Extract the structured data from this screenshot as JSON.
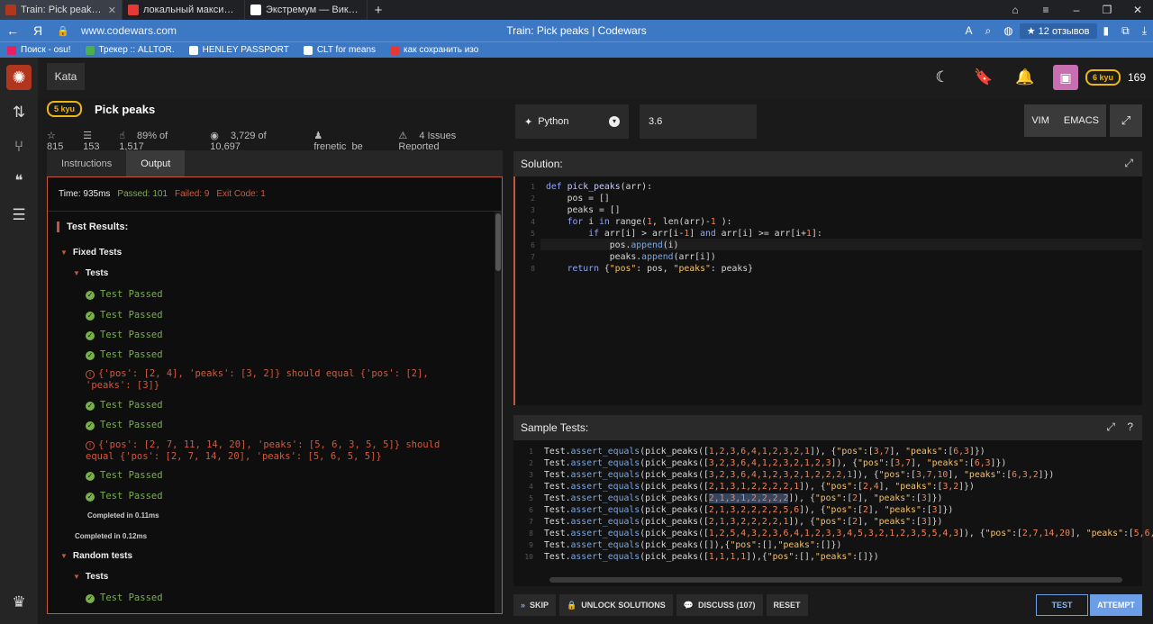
{
  "browser": {
    "tabs": [
      {
        "title": "Train: Pick peaks | Codew",
        "color": "#b1361e"
      },
      {
        "title": "локальный максимум — Я",
        "color": "#e53935"
      },
      {
        "title": "Экстремум — Википедия",
        "color": "#ffffff"
      }
    ],
    "new_tab": "+",
    "url": "www.codewars.com",
    "page_title": "Train: Pick peaks | Codewars",
    "reviews": "★ 12 отзывов",
    "bookmarks": [
      {
        "label": "Поиск - osu!",
        "color": "#e91e63"
      },
      {
        "label": "Трекер :: ALLTOR.",
        "color": "#4caf50"
      },
      {
        "label": "HENLEY PASSPORT",
        "color": "#ffffff"
      },
      {
        "label": "CLT for means",
        "color": "#ffffff"
      },
      {
        "label": "как сохранить изо",
        "color": "#e53935"
      }
    ]
  },
  "header": {
    "kata_tab": "Kata",
    "rank": "6 kyu",
    "honor": "169"
  },
  "kata": {
    "rank": "5 kyu",
    "name": "Pick peaks",
    "stats": {
      "stars": "☆ 815",
      "collections": "☰ 153",
      "satisfaction": "89% of 1,517",
      "completed": "3,729 of 10,697",
      "author": "frenetic_be",
      "issues": "4 Issues Reported"
    }
  },
  "left_tabs": {
    "instructions": "Instructions",
    "output": "Output"
  },
  "output": {
    "time": "Time: 935ms",
    "passed": "Passed: 101",
    "failed": "Failed: 9",
    "exit": "Exit Code: 1",
    "test_results": "Test Results:",
    "fixed_tests": "Fixed Tests",
    "tests": "Tests",
    "passed_label": "Test Passed",
    "fail1": "{'pos': [2, 4], 'peaks': [3, 2]} should equal {'pos': [2], 'peaks': [3]}",
    "fail2": "{'pos': [2, 7, 11, 14, 20], 'peaks': [5, 6, 3, 5, 5]} should equal {'pos': [2, 7, 14, 20], 'peaks': [5, 6, 5, 5]}",
    "completed_inner": "Completed in 0.11ms",
    "completed_outer": "Completed in 0.12ms",
    "random_tests": "Random tests"
  },
  "language": {
    "name": "Python",
    "version": "3.6",
    "vim": "VIM",
    "emacs": "EMACS"
  },
  "solution": {
    "title": "Solution:",
    "lines": [
      "1",
      "2",
      "3",
      "4",
      "5",
      "6",
      "7",
      "8"
    ]
  },
  "sample": {
    "title": "Sample Tests:",
    "lines": [
      "1",
      "2",
      "3",
      "4",
      "5",
      "6",
      "7",
      "8",
      "9",
      "10"
    ]
  },
  "actions": {
    "skip": "SKIP",
    "unlock": "UNLOCK SOLUTIONS",
    "discuss": "DISCUSS (107)",
    "reset": "RESET",
    "test": "TEST",
    "attempt": "ATTEMPT"
  },
  "colors": {
    "accent": "#6b9ee6",
    "danger": "#c3563b",
    "success": "#79b049",
    "rank": "#ecb613"
  }
}
